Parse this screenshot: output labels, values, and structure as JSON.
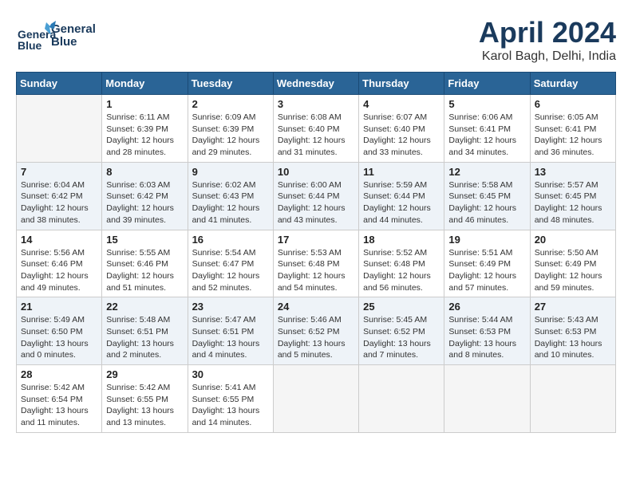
{
  "app": {
    "logo_line1": "General",
    "logo_line2": "Blue"
  },
  "title": "April 2024",
  "location": "Karol Bagh, Delhi, India",
  "weekdays": [
    "Sunday",
    "Monday",
    "Tuesday",
    "Wednesday",
    "Thursday",
    "Friday",
    "Saturday"
  ],
  "weeks": [
    [
      {
        "day": "",
        "empty": true
      },
      {
        "day": "1",
        "sunrise": "6:11 AM",
        "sunset": "6:39 PM",
        "daylight": "12 hours and 28 minutes."
      },
      {
        "day": "2",
        "sunrise": "6:09 AM",
        "sunset": "6:39 PM",
        "daylight": "12 hours and 29 minutes."
      },
      {
        "day": "3",
        "sunrise": "6:08 AM",
        "sunset": "6:40 PM",
        "daylight": "12 hours and 31 minutes."
      },
      {
        "day": "4",
        "sunrise": "6:07 AM",
        "sunset": "6:40 PM",
        "daylight": "12 hours and 33 minutes."
      },
      {
        "day": "5",
        "sunrise": "6:06 AM",
        "sunset": "6:41 PM",
        "daylight": "12 hours and 34 minutes."
      },
      {
        "day": "6",
        "sunrise": "6:05 AM",
        "sunset": "6:41 PM",
        "daylight": "12 hours and 36 minutes."
      }
    ],
    [
      {
        "day": "7",
        "sunrise": "6:04 AM",
        "sunset": "6:42 PM",
        "daylight": "12 hours and 38 minutes."
      },
      {
        "day": "8",
        "sunrise": "6:03 AM",
        "sunset": "6:42 PM",
        "daylight": "12 hours and 39 minutes."
      },
      {
        "day": "9",
        "sunrise": "6:02 AM",
        "sunset": "6:43 PM",
        "daylight": "12 hours and 41 minutes."
      },
      {
        "day": "10",
        "sunrise": "6:00 AM",
        "sunset": "6:44 PM",
        "daylight": "12 hours and 43 minutes."
      },
      {
        "day": "11",
        "sunrise": "5:59 AM",
        "sunset": "6:44 PM",
        "daylight": "12 hours and 44 minutes."
      },
      {
        "day": "12",
        "sunrise": "5:58 AM",
        "sunset": "6:45 PM",
        "daylight": "12 hours and 46 minutes."
      },
      {
        "day": "13",
        "sunrise": "5:57 AM",
        "sunset": "6:45 PM",
        "daylight": "12 hours and 48 minutes."
      }
    ],
    [
      {
        "day": "14",
        "sunrise": "5:56 AM",
        "sunset": "6:46 PM",
        "daylight": "12 hours and 49 minutes."
      },
      {
        "day": "15",
        "sunrise": "5:55 AM",
        "sunset": "6:46 PM",
        "daylight": "12 hours and 51 minutes."
      },
      {
        "day": "16",
        "sunrise": "5:54 AM",
        "sunset": "6:47 PM",
        "daylight": "12 hours and 52 minutes."
      },
      {
        "day": "17",
        "sunrise": "5:53 AM",
        "sunset": "6:48 PM",
        "daylight": "12 hours and 54 minutes."
      },
      {
        "day": "18",
        "sunrise": "5:52 AM",
        "sunset": "6:48 PM",
        "daylight": "12 hours and 56 minutes."
      },
      {
        "day": "19",
        "sunrise": "5:51 AM",
        "sunset": "6:49 PM",
        "daylight": "12 hours and 57 minutes."
      },
      {
        "day": "20",
        "sunrise": "5:50 AM",
        "sunset": "6:49 PM",
        "daylight": "12 hours and 59 minutes."
      }
    ],
    [
      {
        "day": "21",
        "sunrise": "5:49 AM",
        "sunset": "6:50 PM",
        "daylight": "13 hours and 0 minutes."
      },
      {
        "day": "22",
        "sunrise": "5:48 AM",
        "sunset": "6:51 PM",
        "daylight": "13 hours and 2 minutes."
      },
      {
        "day": "23",
        "sunrise": "5:47 AM",
        "sunset": "6:51 PM",
        "daylight": "13 hours and 4 minutes."
      },
      {
        "day": "24",
        "sunrise": "5:46 AM",
        "sunset": "6:52 PM",
        "daylight": "13 hours and 5 minutes."
      },
      {
        "day": "25",
        "sunrise": "5:45 AM",
        "sunset": "6:52 PM",
        "daylight": "13 hours and 7 minutes."
      },
      {
        "day": "26",
        "sunrise": "5:44 AM",
        "sunset": "6:53 PM",
        "daylight": "13 hours and 8 minutes."
      },
      {
        "day": "27",
        "sunrise": "5:43 AM",
        "sunset": "6:53 PM",
        "daylight": "13 hours and 10 minutes."
      }
    ],
    [
      {
        "day": "28",
        "sunrise": "5:42 AM",
        "sunset": "6:54 PM",
        "daylight": "13 hours and 11 minutes."
      },
      {
        "day": "29",
        "sunrise": "5:42 AM",
        "sunset": "6:55 PM",
        "daylight": "13 hours and 13 minutes."
      },
      {
        "day": "30",
        "sunrise": "5:41 AM",
        "sunset": "6:55 PM",
        "daylight": "13 hours and 14 minutes."
      },
      {
        "day": "",
        "empty": true
      },
      {
        "day": "",
        "empty": true
      },
      {
        "day": "",
        "empty": true
      },
      {
        "day": "",
        "empty": true
      }
    ]
  ]
}
